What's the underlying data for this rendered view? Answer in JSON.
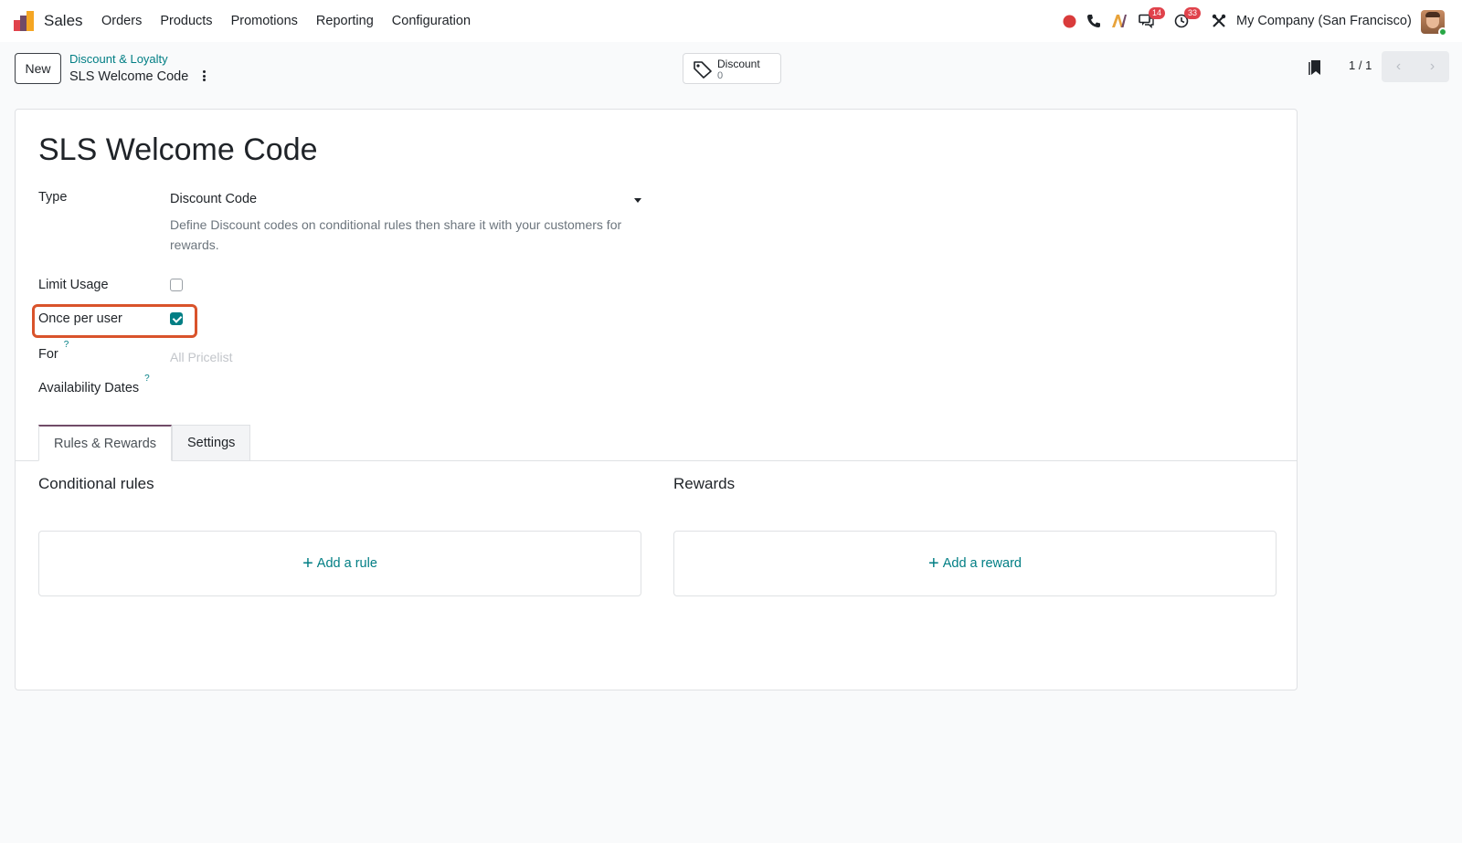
{
  "navbar": {
    "app_name": "Sales",
    "menu": [
      "Orders",
      "Products",
      "Promotions",
      "Reporting",
      "Configuration"
    ],
    "messages_badge": "14",
    "activities_badge": "33",
    "company": "My Company (San Francisco)"
  },
  "control_panel": {
    "new_label": "New",
    "breadcrumb_parent": "Discount & Loyalty",
    "breadcrumb_current": "SLS Welcome Code",
    "smart_button": {
      "label": "Discount",
      "value": "0"
    },
    "pager": "1 / 1"
  },
  "form": {
    "title": "SLS Welcome Code",
    "type_label": "Type",
    "type_value": "Discount Code",
    "type_description": "Define Discount codes on conditional rules then share it with your customers for rewards.",
    "limit_usage_label": "Limit Usage",
    "limit_usage_checked": false,
    "once_per_user_label": "Once per user",
    "once_per_user_checked": true,
    "for_label": "For",
    "for_placeholder": "All Pricelist",
    "availability_label": "Availability Dates",
    "help_marker": "?"
  },
  "tabs": [
    {
      "label": "Rules & Rewards",
      "active": true
    },
    {
      "label": "Settings",
      "active": false
    }
  ],
  "rules": {
    "title": "Conditional rules",
    "add_label": "Add a rule"
  },
  "rewards": {
    "title": "Rewards",
    "add_label": "Add a reward"
  },
  "colors": {
    "accent": "#017e84",
    "brand": "#714b67",
    "highlight": "#d9532b"
  }
}
